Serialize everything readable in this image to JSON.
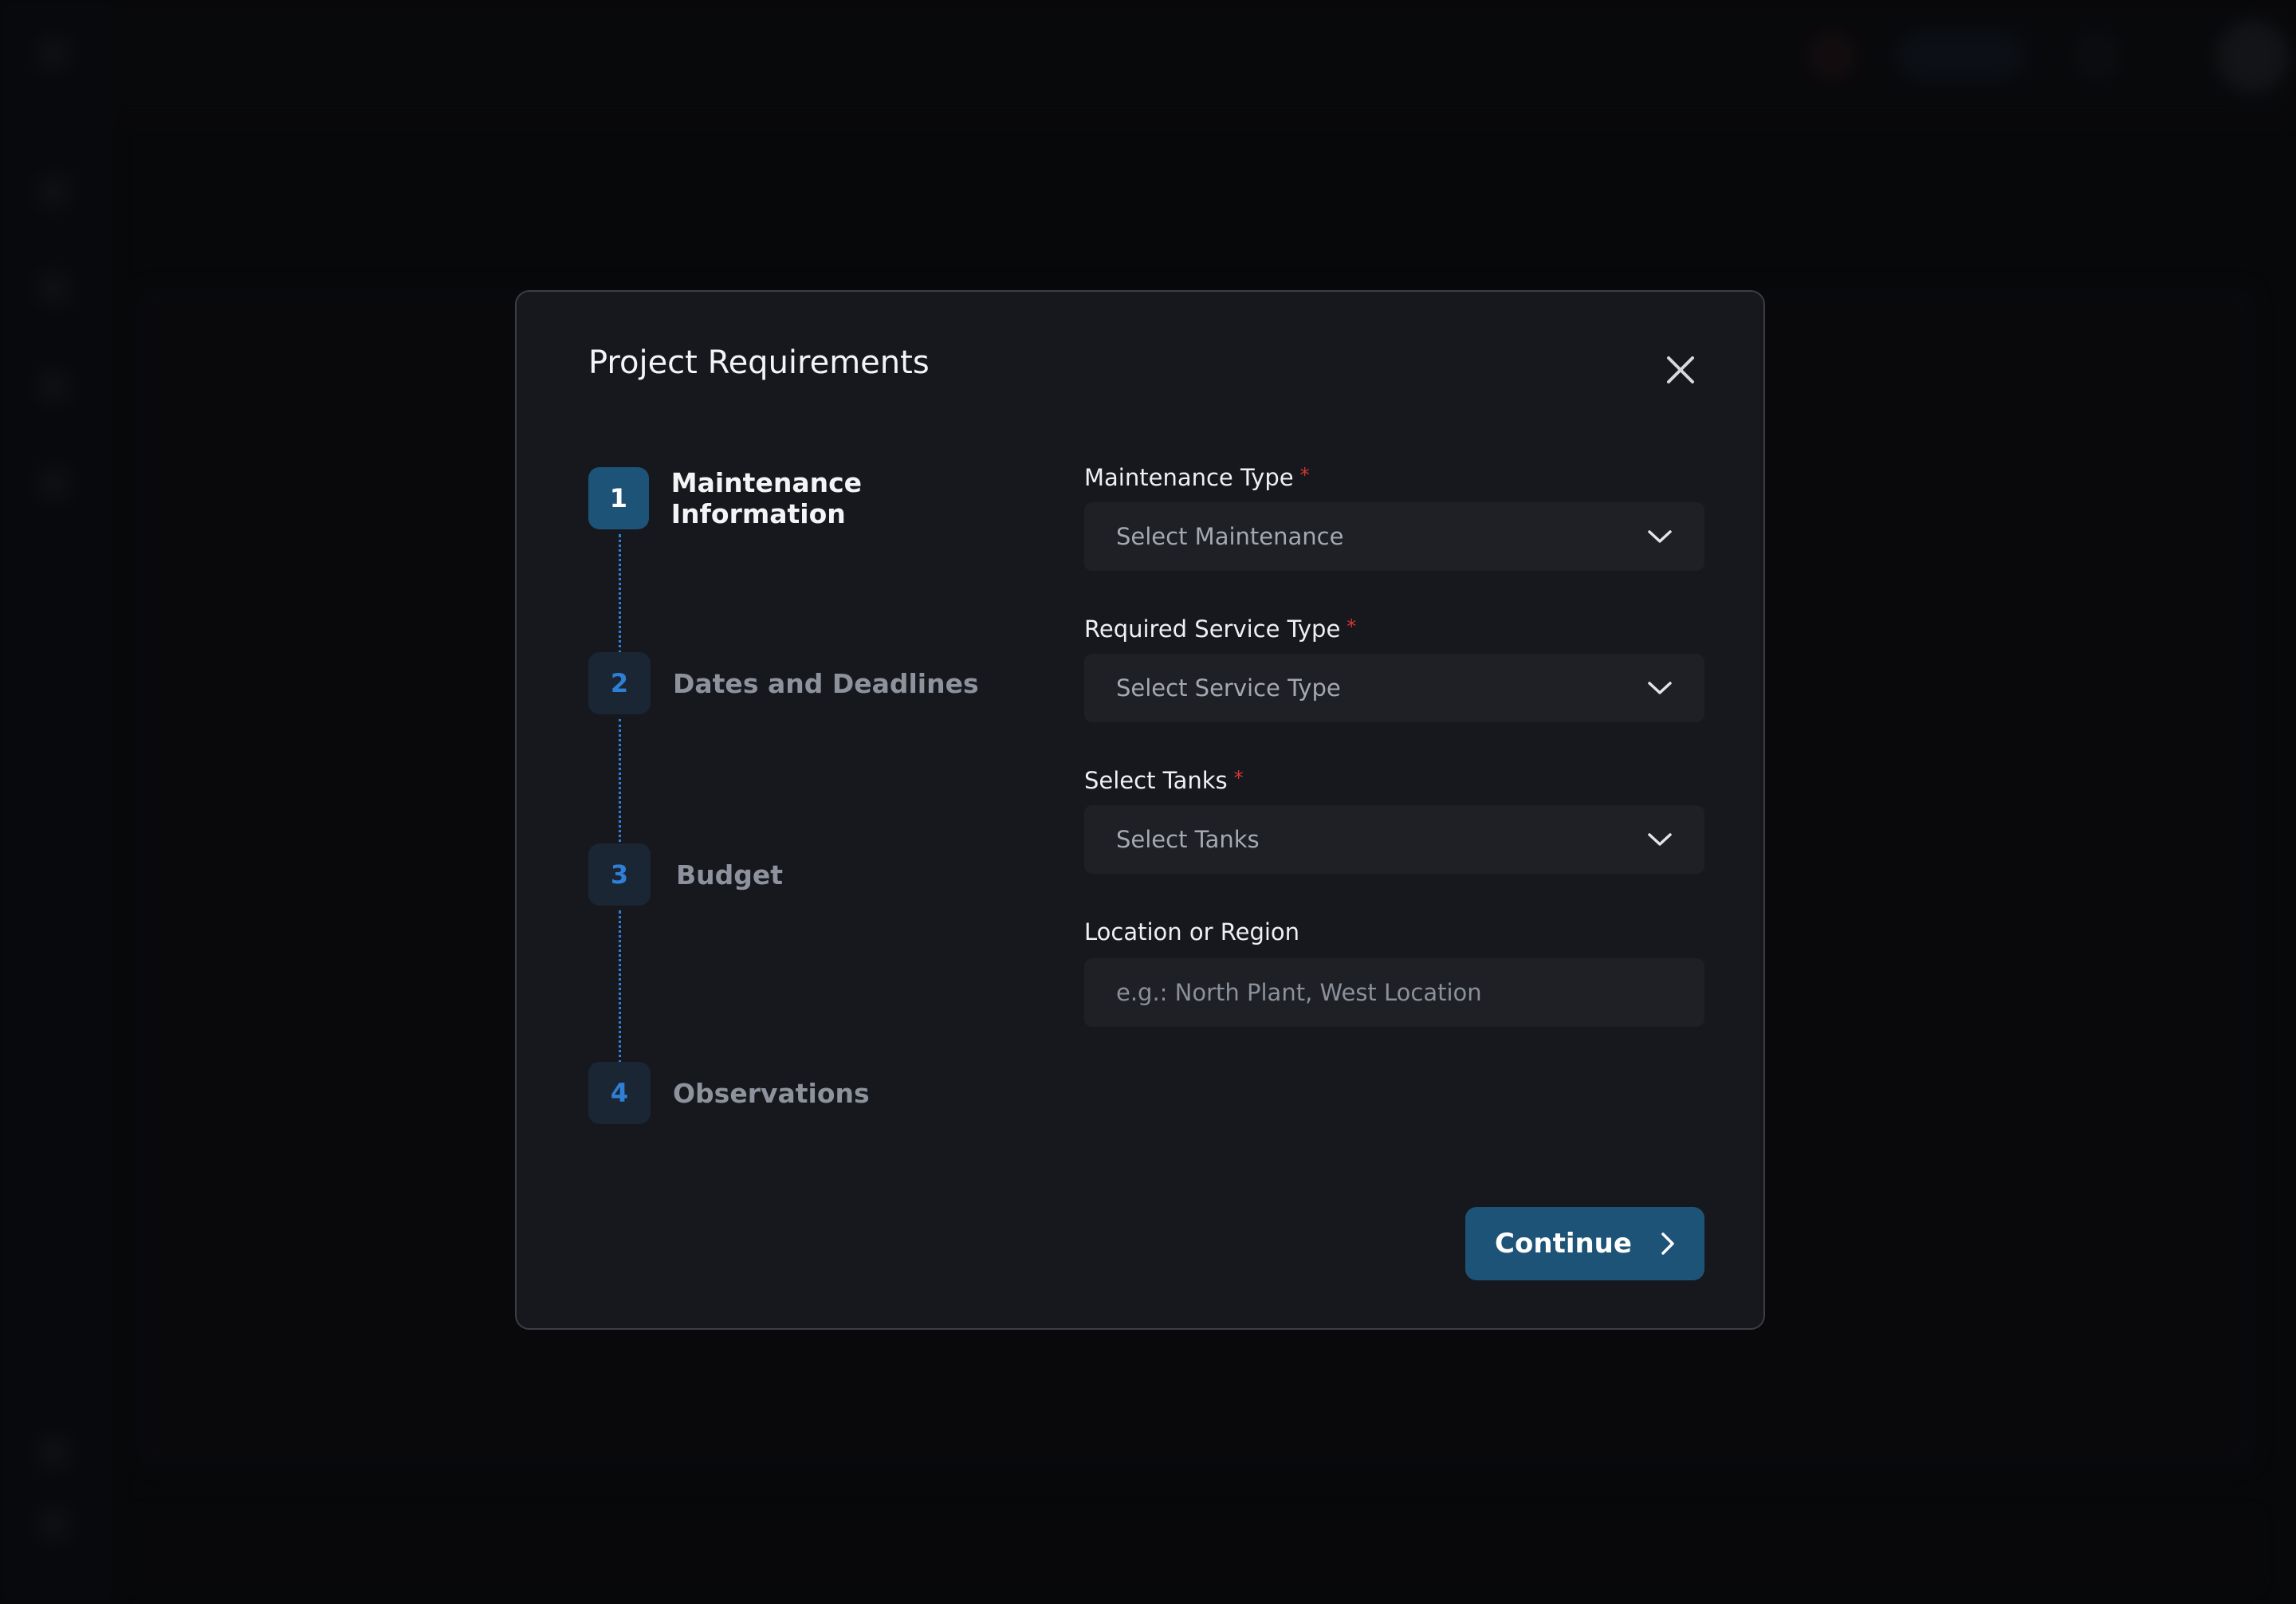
{
  "modal": {
    "title": "Project Requirements"
  },
  "steps": [
    {
      "number": "1",
      "label": "Maintenance Information",
      "state": "active"
    },
    {
      "number": "2",
      "label": "Dates and Deadlines",
      "state": "inactive"
    },
    {
      "number": "3",
      "label": "Budget",
      "state": "inactive"
    },
    {
      "number": "4",
      "label": "Observations",
      "state": "inactive"
    }
  ],
  "form": {
    "maintenance_type": {
      "label": "Maintenance Type",
      "required": "*",
      "value": "Select Maintenance"
    },
    "service_type": {
      "label": "Required Service Type",
      "required": "*",
      "value": "Select Service Type"
    },
    "tanks": {
      "label": "Select Tanks",
      "required": "*",
      "value": "Select Tanks"
    },
    "location": {
      "label": "Location or Region",
      "placeholder": "e.g.: North Plant, West Location",
      "value": ""
    }
  },
  "actions": {
    "continue_label": "Continue"
  },
  "icons": {
    "close": "close-icon",
    "dropdown": "chevron-down-icon",
    "continue": "chevron-right-icon"
  },
  "colors": {
    "accent": "#1e5378",
    "step_inactive_number": "#2f7fd6",
    "required": "#d9362f",
    "modal_background": "#16181e"
  }
}
